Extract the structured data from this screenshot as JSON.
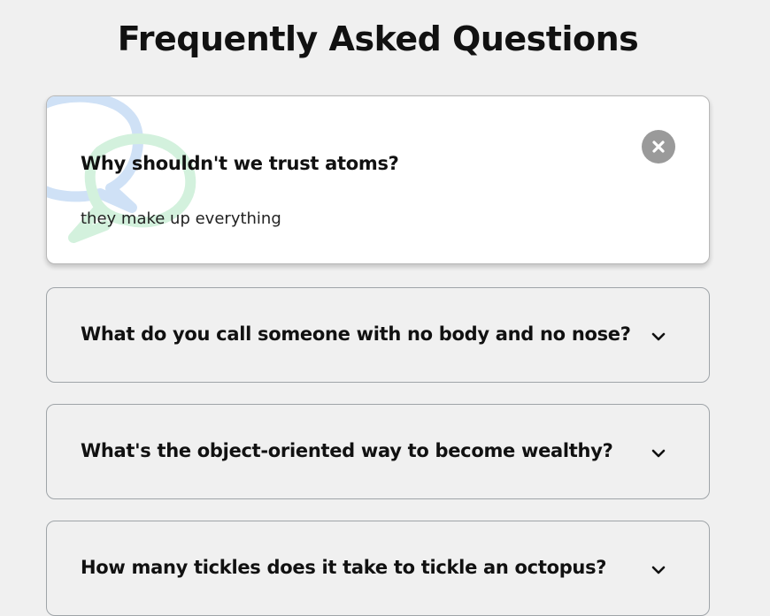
{
  "page": {
    "title": "Frequently Asked Questions"
  },
  "faqs": [
    {
      "question": "Why shouldn't we trust atoms?",
      "answer": "they make up everything",
      "expanded": true,
      "toggle_icon": "close-icon"
    },
    {
      "question": "What do you call someone with no body and no nose?",
      "expanded": false,
      "toggle_icon": "chevron-down-icon"
    },
    {
      "question": "What's the object-oriented way to become wealthy?",
      "expanded": false,
      "toggle_icon": "chevron-down-icon"
    },
    {
      "question": "How many tickles does it take to tickle an octopus?",
      "expanded": false,
      "toggle_icon": "chevron-down-icon"
    }
  ],
  "colors": {
    "page_background": "#f0f0f0",
    "card_active_background": "#ffffff",
    "card_border": "#9fa4a8",
    "close_button": "#9a9a9a",
    "bubble_blue": "#cfe1f6",
    "bubble_green": "#d3f1dd"
  }
}
